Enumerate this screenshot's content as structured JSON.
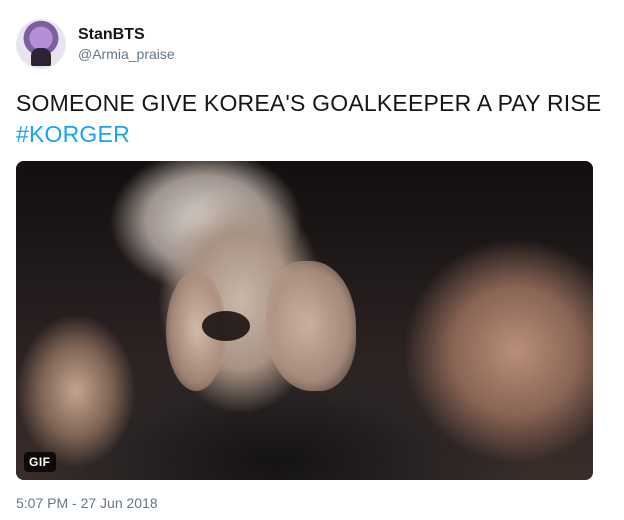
{
  "user": {
    "display_name": "StanBTS",
    "handle": "@Armia_praise"
  },
  "tweet": {
    "text": "SOMEONE GIVE KOREA'S GOALKEEPER A PAY RISE",
    "hashtag": "#KORGER",
    "timestamp": "5:07 PM - 27 Jun 2018"
  },
  "media": {
    "badge": "GIF"
  },
  "colors": {
    "link": "#1da1f2",
    "secondary_text": "#657786",
    "primary_text": "#14171a"
  }
}
